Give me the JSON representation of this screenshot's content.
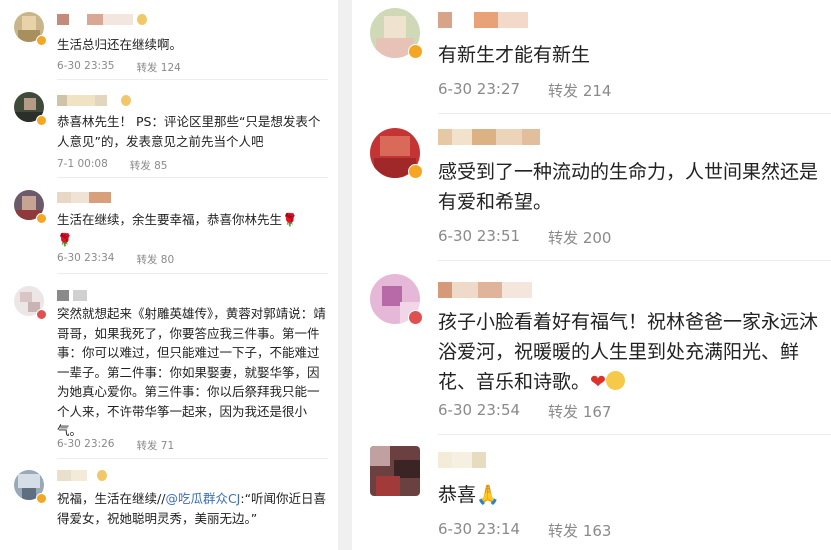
{
  "left_comments": [
    {
      "text": "生活总归还在继续啊。",
      "time": "6-30 23:35",
      "repost_label": "转发",
      "repost_count": "124"
    },
    {
      "text": "恭喜林先生！ PS：评论区里那些“只是想发表个人意见”的，发表意见之前先当个人吧",
      "time": "7-1 00:08",
      "repost_label": "转发",
      "repost_count": "85"
    },
    {
      "text": "生活在继续，余生要幸福，恭喜你林先生",
      "time": "6-30 23:34",
      "repost_label": "转发",
      "repost_count": "80"
    },
    {
      "text": "突然就想起来《射雕英雄传》，黄蓉对郭靖说：靖哥哥，如果我死了，你要答应我三件事。第一件事：你可以难过，但只能难过一下子，不能难过一辈子。第二件事：你如果娶妻，就娶华筝，因为她真心爱你。第三件事：你以后祭拜我只能一个人来，不许带华筝一起来，因为我还是很小气。",
      "time": "6-30 23:26",
      "repost_label": "转发",
      "repost_count": "71"
    },
    {
      "text_before": "祝福，生活在继续//",
      "mention": "@吃瓜群众CJ",
      "text_after": ":“听闻你近日喜得爱女，祝她聪明灵秀，美丽无边。”"
    }
  ],
  "right_comments": [
    {
      "text": "有新生才能有新生",
      "time": "6-30 23:27",
      "repost_label": "转发",
      "repost_count": "214"
    },
    {
      "text": "感受到了一种流动的生命力，人世间果然还是有爱和希望。",
      "time": "6-30 23:51",
      "repost_label": "转发",
      "repost_count": "200"
    },
    {
      "text": "孩子小脸看着好有福气！祝林爸爸一家永远沐浴爱河，祝暖暖的人生里到处充满阳光、鲜花、音乐和诗歌。",
      "time": "6-30 23:54",
      "repost_label": "转发",
      "repost_count": "167"
    },
    {
      "text": "恭喜",
      "time": "6-30 23:14",
      "repost_label": "转发",
      "repost_count": "163"
    }
  ],
  "icons": {
    "heart": "heart-icon",
    "smile": "smile-emoji-icon",
    "rose": "rose-icon",
    "clap": "clap-icon",
    "verified": "verified-badge-icon"
  },
  "colors": {
    "accent_link": "#3d6fb6",
    "meta_gray": "#8a8a8a",
    "verified_badge": "#f5a623"
  }
}
